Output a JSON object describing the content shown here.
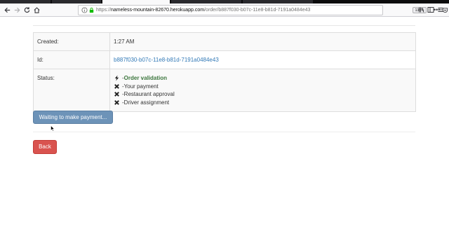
{
  "browser": {
    "url_host": "nameless-mountain-82670.herokuapp.com",
    "url_path": "/order/b887f030-b07c-11e8-b81d-7191a0484e43",
    "url_scheme": "https://",
    "zoom": "133%",
    "more_label": "•••"
  },
  "order": {
    "rows": {
      "created": {
        "label": "Created:",
        "value": "1:27 AM"
      },
      "id": {
        "label": "Id:",
        "value": "b887f030-b07c-11e8-b81d-7191a0484e43"
      },
      "status": {
        "label": "Status:"
      }
    },
    "status_steps": [
      {
        "label": "Order validation",
        "icon": "bolt-icon",
        "state": "current"
      },
      {
        "label": "Your payment",
        "icon": "x-icon",
        "state": "pending"
      },
      {
        "label": "Restaurant approval",
        "icon": "x-icon",
        "state": "pending"
      },
      {
        "label": "Driver assignment",
        "icon": "x-icon",
        "state": "pending"
      }
    ],
    "dash": "-"
  },
  "actions": {
    "waiting_label": "Waiting to make payment...",
    "back_label": "Back"
  },
  "colors": {
    "current_step": "#3c763d",
    "link": "#337ab7",
    "waiting_button": "#6d93b8",
    "back_button": "#d9534f"
  }
}
